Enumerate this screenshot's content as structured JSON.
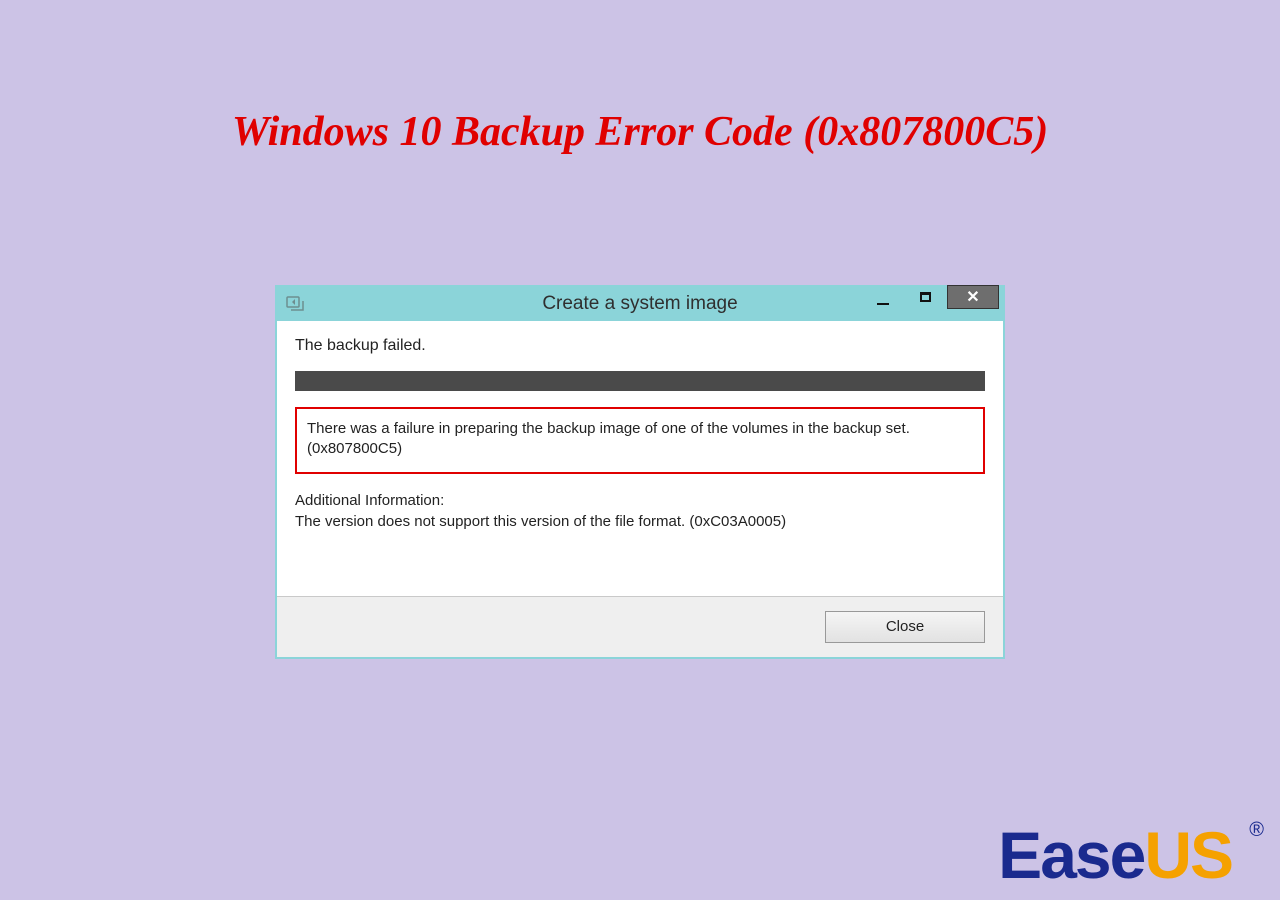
{
  "page": {
    "title": "Windows 10 Backup Error Code (0x807800C5)"
  },
  "dialog": {
    "title": "Create a system image",
    "heading": "The backup failed.",
    "error_line1": "There was a failure in preparing the backup image of one of the volumes in the backup set.",
    "error_line2": "(0x807800C5)",
    "additional_label": "Additional Information:",
    "additional_text": "The version does not support this version of the file format. (0xC03A0005)",
    "close_label": "Close"
  },
  "brand": {
    "part1": "Ease",
    "part2": "US",
    "reg": "®"
  }
}
